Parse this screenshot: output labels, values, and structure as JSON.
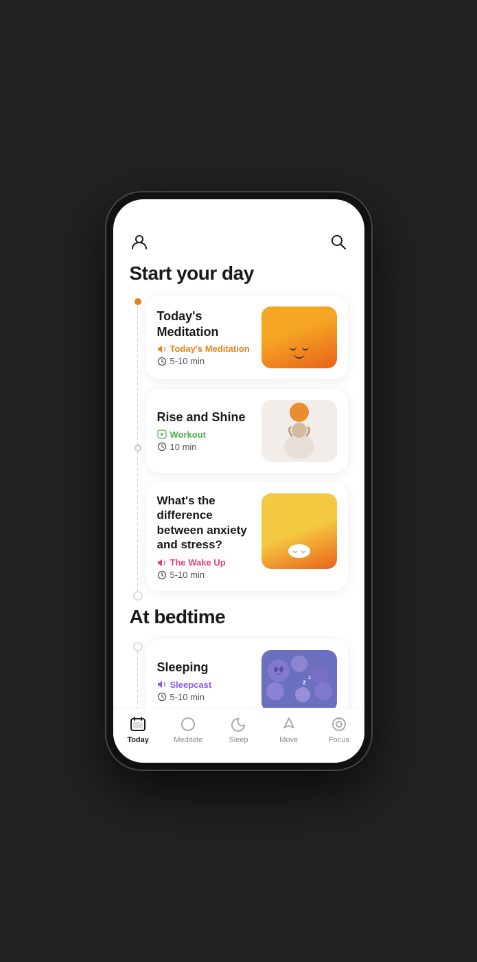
{
  "app": {
    "title": "Start your day",
    "section2_title": "At bedtime"
  },
  "cards": [
    {
      "id": "meditation",
      "title": "Today's\nMeditation",
      "tag_color": "orange",
      "tag_text": "Today's Meditation",
      "time": "5-10 min",
      "image_type": "meditation"
    },
    {
      "id": "rise",
      "title": "Rise and Shine",
      "tag_color": "green",
      "tag_text": "Workout",
      "time": "10 min",
      "image_type": "rise"
    },
    {
      "id": "anxiety",
      "title": "What's the difference between anxiety and stress?",
      "tag_color": "pink",
      "tag_text": "The Wake Up",
      "time": "5-10 min",
      "image_type": "anxiety"
    }
  ],
  "bedtime_cards": [
    {
      "id": "sleeping",
      "title": "Sleeping",
      "tag_color": "purple",
      "tag_text": "Sleepcast",
      "time": "5-10 min",
      "image_type": "sleeping"
    }
  ],
  "nav": {
    "items": [
      {
        "id": "today",
        "label": "Today",
        "active": true
      },
      {
        "id": "meditate",
        "label": "Meditate",
        "active": false
      },
      {
        "id": "sleep",
        "label": "Sleep",
        "active": false
      },
      {
        "id": "move",
        "label": "Move",
        "active": false
      },
      {
        "id": "focus",
        "label": "Focus",
        "active": false
      }
    ]
  },
  "icons": {
    "person": "👤",
    "search": "🔍",
    "volume": "🔊",
    "clock": "⏱",
    "play": "▶"
  }
}
